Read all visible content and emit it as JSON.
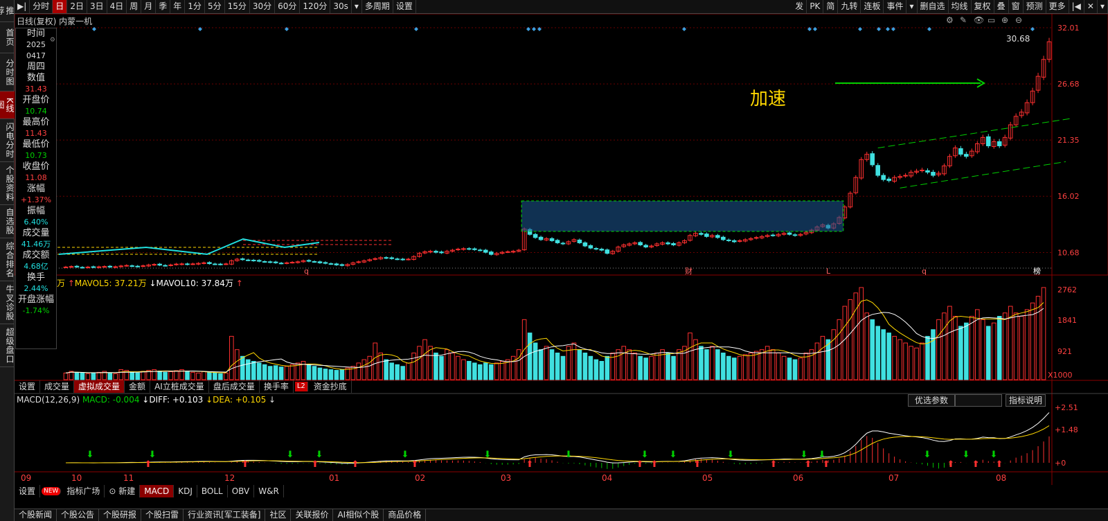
{
  "leftnav": [
    "推荐",
    "首页",
    "分时图",
    "K线图",
    "闪电分时",
    "个股资料",
    "自选股",
    "综合排名",
    "牛叉诊股",
    "超级盘口"
  ],
  "toolbar": {
    "left": [
      "分时",
      "日",
      "2日",
      "3日",
      "4日",
      "周",
      "月",
      "季",
      "年",
      "1分",
      "5分",
      "15分",
      "30分",
      "60分",
      "120分",
      "30s",
      "多周期",
      "设置"
    ],
    "active": "日",
    "right": [
      "发",
      "PK",
      "简",
      "九转",
      "连板",
      "事件",
      "删自选",
      "均线",
      "复权",
      "叠",
      "窗",
      "预测",
      "更多"
    ]
  },
  "title": "日线(复权)  内蒙一机",
  "info": [
    {
      "label": "时间",
      "value": "2025",
      "color": "#dddddd"
    },
    {
      "label": "",
      "value": "0417",
      "color": "#dddddd"
    },
    {
      "label": "周四",
      "value": "",
      "color": "#dddddd"
    },
    {
      "label": "数值",
      "value": "31.43",
      "color": "#ff4040"
    },
    {
      "label": "开盘价",
      "value": "10.74",
      "color": "#00d000"
    },
    {
      "label": "最高价",
      "value": "11.43",
      "color": "#ff4040"
    },
    {
      "label": "最低价",
      "value": "10.73",
      "color": "#00d000"
    },
    {
      "label": "收盘价",
      "value": "11.08",
      "color": "#ff4040"
    },
    {
      "label": "涨幅",
      "value": "+1.37%",
      "color": "#ff4040"
    },
    {
      "label": "振幅",
      "value": "6.40%",
      "color": "#20e0e0"
    },
    {
      "label": "成交量",
      "value": "41.46万",
      "color": "#20e0e0"
    },
    {
      "label": "成交额",
      "value": "4.68亿",
      "color": "#20e0e0"
    },
    {
      "label": "换手",
      "value": "2.44%",
      "color": "#20e0e0"
    },
    {
      "label": "开盘涨幅",
      "value": "-1.74%",
      "color": "#00d000"
    }
  ],
  "price_axis": [
    "32.01",
    "26.68",
    "21.35",
    "16.02",
    "10.68"
  ],
  "price_top_label": "30.68",
  "annotation": "加速",
  "events": [
    "q",
    "财",
    "L",
    "q",
    "榜"
  ],
  "volume": {
    "legend": "万 ↑MAVOL5: 37.21万 ↓MAVOL10: 37.84万 ↑",
    "axis": [
      "2762",
      "1841",
      "921",
      "X1000"
    ]
  },
  "indicator_tabs": [
    "设置",
    "成交量",
    "虚拟成交量",
    "金额",
    "AI立桩成交量",
    "盘后成交量",
    "换手率",
    "L2",
    "资金抄底"
  ],
  "indicator_active": "虚拟成交量",
  "macd": {
    "legend": "MACD(12,26,9) MACD: -0.004 ↓DIFF: +0.103 ↓DEA: +0.105 ↓",
    "axis": [
      "2.51",
      "1.48",
      "0"
    ],
    "opt_button": "优选参数",
    "explain_button": "指标说明"
  },
  "months": [
    "09",
    "10",
    "11",
    "12",
    "01",
    "02",
    "03",
    "04",
    "05",
    "06",
    "07",
    "08"
  ],
  "bottom_tabs": [
    "设置",
    "NEW",
    "指标广场",
    "新建",
    "MACD",
    "KDJ",
    "BOLL",
    "OBV",
    "W&R"
  ],
  "bottom_active": "MACD",
  "bottom_links": [
    "个股新闻",
    "个股公告",
    "个股研报",
    "个股扫雷",
    "行业资讯[军工装备]",
    "社区",
    "关联报价",
    "AI相似个股",
    "商品价格"
  ],
  "chart_data": {
    "type": "candlestick",
    "ylim": [
      9.0,
      32.01
    ],
    "closes": [
      9.3,
      9.35,
      9.3,
      9.25,
      9.3,
      9.28,
      9.32,
      9.35,
      9.3,
      9.33,
      9.4,
      9.45,
      9.38,
      9.35,
      9.42,
      9.5,
      9.55,
      9.48,
      9.45,
      9.5,
      9.58,
      9.6,
      9.55,
      9.6,
      9.65,
      9.7,
      9.62,
      9.58,
      9.55,
      9.6,
      9.9,
      10.05,
      10.0,
      9.95,
      9.9,
      9.85,
      9.8,
      9.75,
      9.7,
      9.65,
      9.7,
      9.75,
      9.8,
      9.9,
      9.85,
      9.8,
      9.7,
      9.65,
      9.6,
      9.5,
      9.45,
      9.55,
      9.7,
      9.8,
      9.9,
      10.0,
      10.1,
      10.2,
      10.15,
      10.1,
      10.05,
      10.0,
      10.05,
      10.3,
      10.6,
      10.75,
      10.8,
      10.7,
      10.65,
      10.8,
      10.9,
      11.0,
      11.05,
      11.0,
      10.95,
      10.9,
      10.7,
      10.5,
      10.6,
      10.7,
      10.75,
      10.8,
      10.9,
      12.9,
      12.4,
      12.1,
      11.9,
      12.0,
      11.8,
      11.6,
      11.5,
      11.7,
      11.9,
      11.6,
      11.3,
      11.1,
      11.0,
      10.9,
      10.6,
      10.8,
      11.2,
      11.4,
      11.5,
      11.6,
      11.4,
      11.2,
      11.3,
      11.5,
      11.6,
      11.5,
      11.4,
      11.6,
      11.8,
      12.3,
      12.5,
      12.4,
      12.2,
      12.3,
      12.1,
      11.9,
      11.8,
      11.7,
      11.8,
      11.9,
      12.0,
      12.1,
      12.2,
      12.3,
      12.3,
      12.4,
      12.5,
      12.4,
      12.3,
      12.4,
      12.6,
      12.8,
      13.1,
      13.3,
      13.0,
      13.4,
      14.0,
      15.0,
      16.3,
      17.8,
      19.5,
      20.0,
      19.0,
      18.0,
      17.6,
      17.5,
      17.8,
      17.9,
      18.0,
      18.3,
      18.4,
      18.5,
      18.3,
      18.0,
      18.2,
      18.9,
      19.8,
      20.6,
      20.0,
      19.8,
      20.3,
      21.0,
      21.6,
      20.8,
      21.2,
      20.8,
      21.6,
      22.8,
      23.6,
      24.0,
      24.9,
      26.0,
      27.4,
      29.0,
      30.68
    ],
    "volumes": [
      0.2,
      0.25,
      0.22,
      0.2,
      0.18,
      0.2,
      0.22,
      0.25,
      0.2,
      0.18,
      0.3,
      0.28,
      0.22,
      0.2,
      0.25,
      0.28,
      0.3,
      0.26,
      0.22,
      0.24,
      0.27,
      0.3,
      0.25,
      0.22,
      0.2,
      0.24,
      0.22,
      0.2,
      0.18,
      0.2,
      1.3,
      0.9,
      0.7,
      0.6,
      0.55,
      0.5,
      0.45,
      0.4,
      0.42,
      0.38,
      0.4,
      0.45,
      0.5,
      0.55,
      0.45,
      0.4,
      0.35,
      0.32,
      0.3,
      0.28,
      0.3,
      0.35,
      0.4,
      0.5,
      0.6,
      0.7,
      1.1,
      0.8,
      0.6,
      0.5,
      0.45,
      0.4,
      0.5,
      0.8,
      1.0,
      1.2,
      1.0,
      0.8,
      0.7,
      0.9,
      0.8,
      0.7,
      0.6,
      0.55,
      0.5,
      0.45,
      0.5,
      0.45,
      0.5,
      0.55,
      0.6,
      0.7,
      0.9,
      1.8,
      1.4,
      1.1,
      0.9,
      1.0,
      0.9,
      0.8,
      0.7,
      1.0,
      1.1,
      0.9,
      0.8,
      0.7,
      0.6,
      0.55,
      0.7,
      0.8,
      0.9,
      1.0,
      0.9,
      0.8,
      0.7,
      0.65,
      0.7,
      0.8,
      0.9,
      0.8,
      0.7,
      0.9,
      1.0,
      1.4,
      1.2,
      1.0,
      0.9,
      1.0,
      0.9,
      0.8,
      0.7,
      0.65,
      0.7,
      0.75,
      0.8,
      0.85,
      0.9,
      1.0,
      0.9,
      0.8,
      0.7,
      0.65,
      0.6,
      0.65,
      0.8,
      0.9,
      1.1,
      1.3,
      1.2,
      1.5,
      1.8,
      2.2,
      2.4,
      2.6,
      2.762,
      2.0,
      1.8,
      1.6,
      1.5,
      1.4,
      1.3,
      1.2,
      1.1,
      1.0,
      0.95,
      1.1,
      1.3,
      1.5,
      1.8,
      2.0,
      2.2,
      1.9,
      1.6,
      1.7,
      1.9,
      2.1,
      1.8,
      1.6,
      1.7,
      1.9,
      2.0,
      2.2,
      2.0,
      1.9,
      2.1,
      2.3,
      2.5,
      2.762
    ]
  }
}
